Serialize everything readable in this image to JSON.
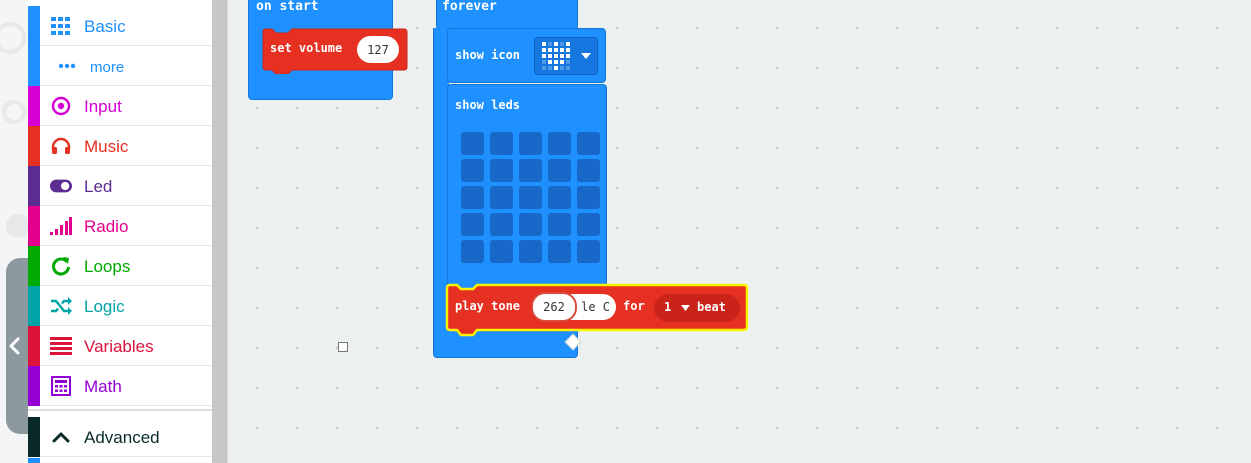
{
  "toolbox": {
    "categories": [
      {
        "id": "basic",
        "label": "Basic",
        "color": "#1e90ff",
        "icon": "grid-icon"
      },
      {
        "id": "more",
        "label": "more",
        "color": "#1e90ff",
        "icon": "ellipsis-icon"
      },
      {
        "id": "input",
        "label": "Input",
        "color": "#d400d4",
        "icon": "target-icon"
      },
      {
        "id": "music",
        "label": "Music",
        "color": "#e63022",
        "icon": "headphones-icon"
      },
      {
        "id": "led",
        "label": "Led",
        "color": "#5c2d91",
        "icon": "toggle-icon"
      },
      {
        "id": "radio",
        "label": "Radio",
        "color": "#e3008c",
        "icon": "signal-bars-icon"
      },
      {
        "id": "loops",
        "label": "Loops",
        "color": "#00aa00",
        "icon": "refresh-icon"
      },
      {
        "id": "logic",
        "label": "Logic",
        "color": "#00a4a6",
        "icon": "shuffle-icon"
      },
      {
        "id": "variables",
        "label": "Variables",
        "color": "#dc143c",
        "icon": "lines-icon"
      },
      {
        "id": "math",
        "label": "Math",
        "color": "#9400d3",
        "icon": "calculator-icon"
      },
      {
        "id": "advanced",
        "label": "Advanced",
        "color": "#0a2a2a",
        "icon": "chevron-up-icon"
      }
    ]
  },
  "blocks": {
    "on_start": {
      "label": "on start"
    },
    "set_volume": {
      "label": "set volume",
      "value": "127"
    },
    "forever": {
      "label": "forever"
    },
    "show_icon": {
      "label": "show icon"
    },
    "show_leds": {
      "label": "show leds"
    },
    "play_tone": {
      "label": "play tone",
      "value": "262",
      "note_fragment": "le C",
      "for_label": "for",
      "beat_value": "1",
      "beat_label": "beat"
    }
  },
  "colors": {
    "basic": "#1e90ff",
    "music": "#e63022",
    "workspace": "#ecf0f1",
    "highlight": "#fff200"
  }
}
